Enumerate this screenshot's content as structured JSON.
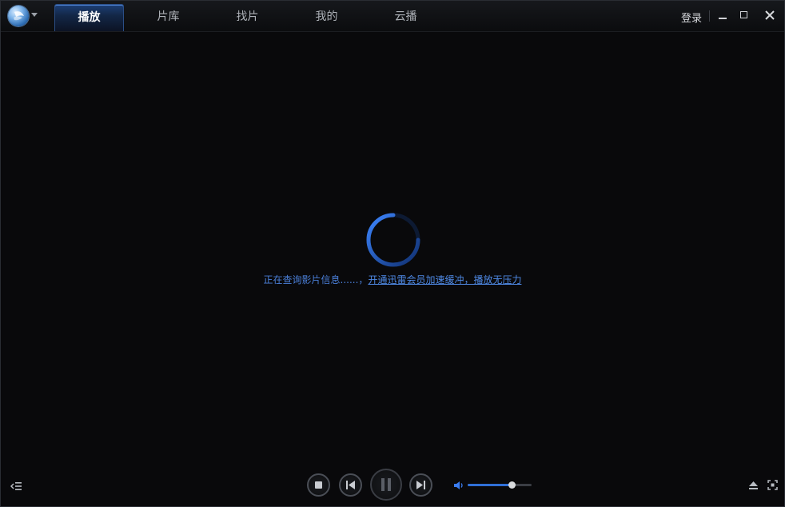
{
  "window": {
    "tabs": [
      {
        "label": "播放",
        "active": true
      },
      {
        "label": "片库",
        "active": false
      },
      {
        "label": "找片",
        "active": false
      },
      {
        "label": "我的",
        "active": false
      },
      {
        "label": "云播",
        "active": false
      }
    ],
    "login_label": "登录"
  },
  "main": {
    "status_text": "正在查询影片信息......，",
    "vip_link_text": "开通迅雷会员加速缓冲，播放无压力"
  },
  "controls": {
    "volume_level": 0.69
  },
  "colors": {
    "accent": "#2f6fd6",
    "link": "#4f8ae6",
    "background": "#09090b"
  },
  "icons": {
    "logo": "xunlei-player-logo",
    "menu": "chevron-down-icon",
    "minimize": "minimize-icon",
    "maximize": "maximize-icon",
    "close": "close-icon",
    "playlist": "playlist-toggle-icon",
    "stop": "stop-icon",
    "previous": "previous-icon",
    "pause": "pause-icon",
    "next": "next-icon",
    "volume": "volume-icon",
    "eject": "eject-icon",
    "fullscreen": "fullscreen-icon",
    "loading": "loading-spinner"
  }
}
